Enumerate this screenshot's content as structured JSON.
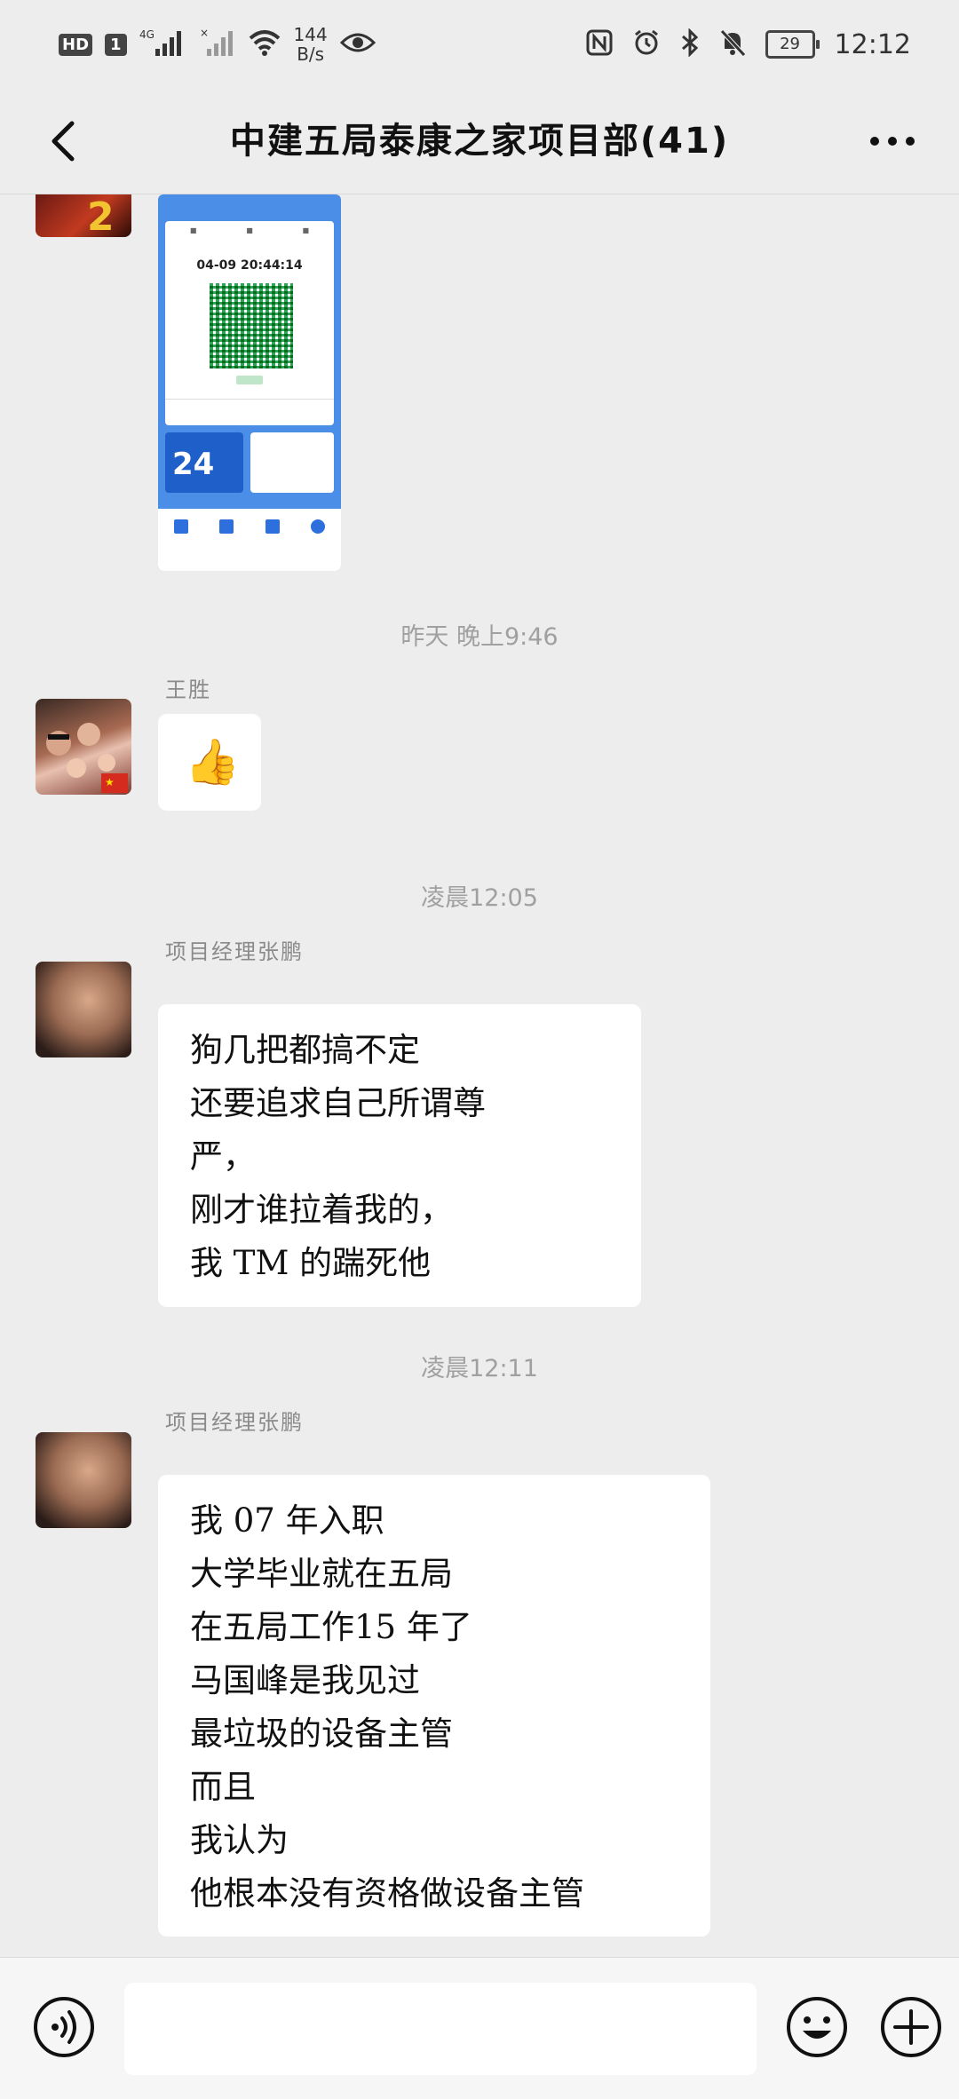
{
  "status_bar": {
    "hd": "HD",
    "sim": "1",
    "network": "4G",
    "speed_value": "144",
    "speed_unit": "B/s",
    "battery": "29",
    "time": "12:12"
  },
  "header": {
    "title": "中建五局泰康之家项目部(41)"
  },
  "health_code_image": {
    "datetime": "04-09 20:44:14",
    "hours_value": "24"
  },
  "messages": [
    {
      "timestamp": "昨天 晚上9:46",
      "sender": "王胜",
      "emoji": "👍"
    },
    {
      "timestamp": "凌晨12:05",
      "sender": "项目经理张鹏",
      "lines": [
        "狗几把都搞不定",
        "还要追求自己所谓尊",
        "严，",
        "刚才谁拉着我的，",
        "我 TM 的踹死他"
      ]
    },
    {
      "timestamp": "凌晨12:11",
      "sender": "项目经理张鹏",
      "lines": [
        "我 07 年入职",
        "大学毕业就在五局",
        "在五局工作15 年了",
        "马国峰是我见过",
        "最垃圾的设备主管",
        "而且",
        "我认为",
        "他根本没有资格做设备主管"
      ]
    }
  ],
  "input": {
    "placeholder": ""
  },
  "icons": {
    "back": "chevron-left-icon",
    "more": "more-dots-icon",
    "voice": "voice-icon",
    "emoji": "emoji-icon",
    "plus": "plus-icon"
  }
}
